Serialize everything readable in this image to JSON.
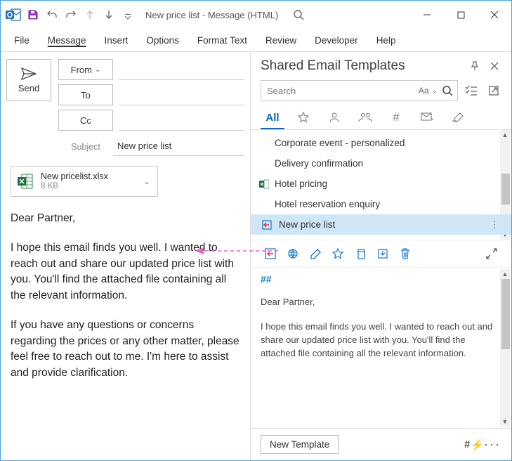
{
  "window": {
    "title": "New price list  -  Message (HTML)"
  },
  "ribbon": {
    "items": [
      "File",
      "Message",
      "Insert",
      "Options",
      "Format Text",
      "Review",
      "Developer",
      "Help"
    ],
    "active_index": 1
  },
  "compose": {
    "send_label": "Send",
    "from_label": "From",
    "to_label": "To",
    "cc_label": "Cc",
    "subject_label": "Subject",
    "subject_value": "New price list",
    "attachment": {
      "name": "New pricelist.xlsx",
      "size": "8 KB"
    },
    "greeting": "Dear Partner,",
    "para1": "I hope this email finds you well. I wanted to reach out and share our updated price list with you. You'll find the attached file containing all the relevant information.",
    "para2": "If you have any questions or concerns regarding the prices or any other matter, please feel free to reach out to me. I'm here to assist and provide clarification."
  },
  "panel": {
    "title": "Shared Email Templates",
    "search_placeholder": "Search",
    "search_aa": "Aa",
    "filters": {
      "all_label": "All"
    },
    "templates": [
      {
        "label": "Corporate event - personalized"
      },
      {
        "label": "Delivery confirmation"
      },
      {
        "label": "Hotel pricing",
        "excel": true
      },
      {
        "label": "Hotel reservation enquiry"
      },
      {
        "label": "New price list",
        "selected": true
      }
    ],
    "preview": {
      "marker": "##",
      "greeting": "Dear Partner,",
      "body": "I hope this email finds you well. I wanted to reach out and share our updated price list with you. You'll find the attached file containing all the relevant information."
    },
    "new_template_label": "New Template"
  }
}
